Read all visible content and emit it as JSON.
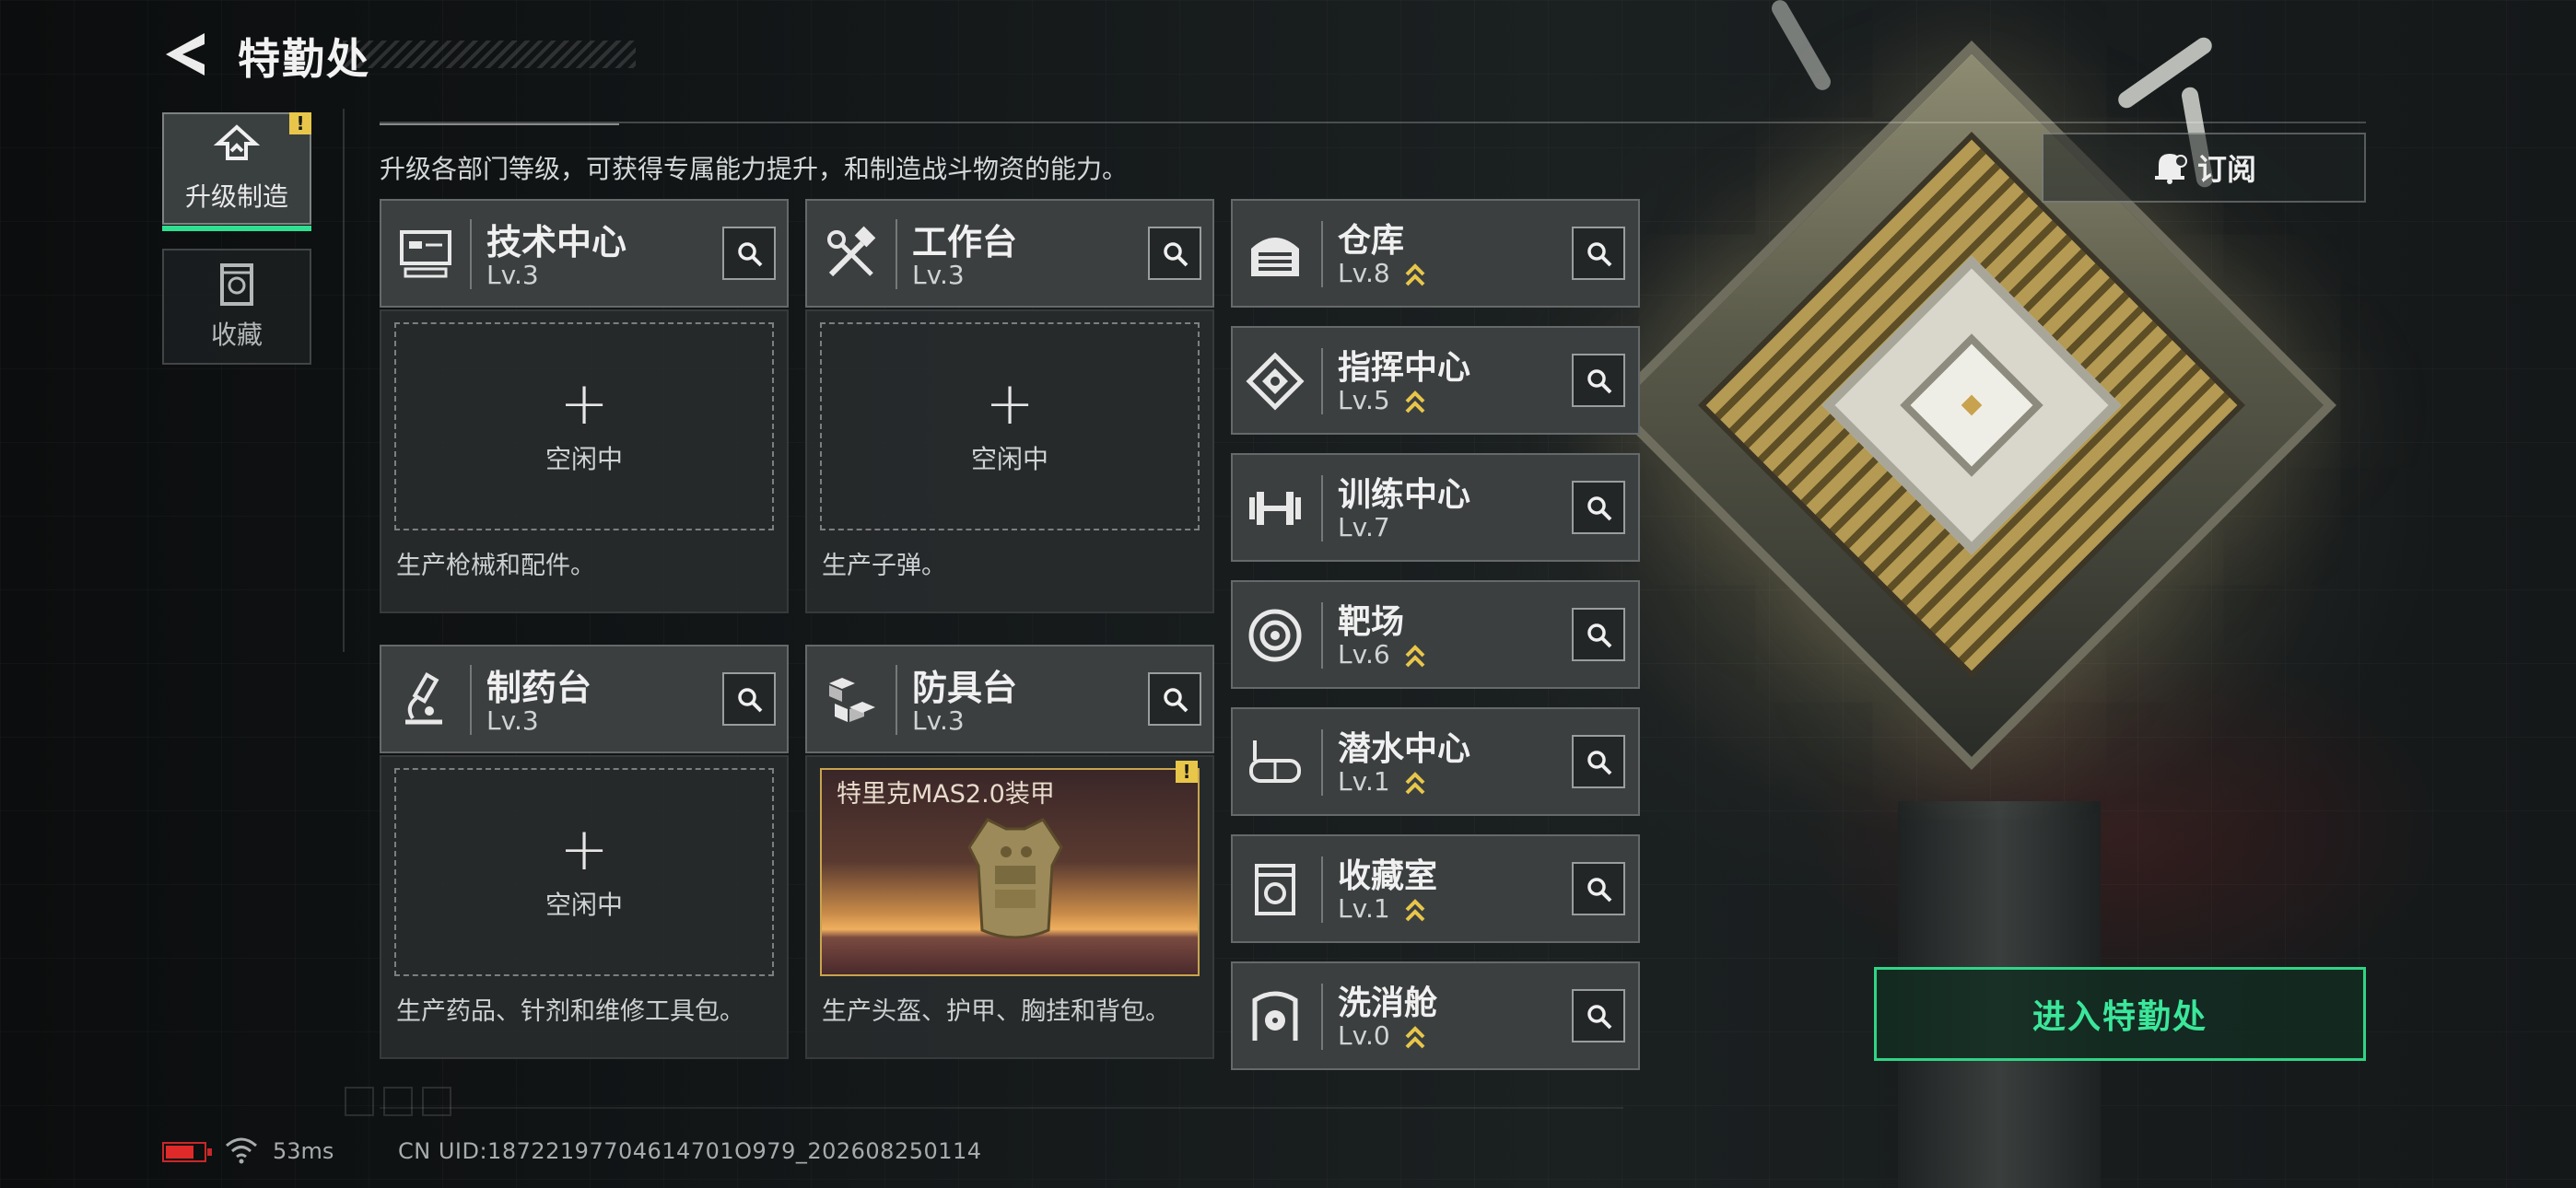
{
  "header": {
    "title": "特勤处",
    "subtitle": "升级各部门等级，可获得专属能力提升，和制造战斗物资的能力。"
  },
  "sidebar": {
    "tabs": [
      {
        "label": "升级制造",
        "icon": "upgrade-icon",
        "active": true,
        "alert": "!"
      },
      {
        "label": "收藏",
        "icon": "collection-icon",
        "active": false
      }
    ]
  },
  "workshops": [
    {
      "name": "技术中心",
      "level": "Lv.3",
      "icon": "computer-icon",
      "status": "空闲中",
      "description": "生产枪械和配件。"
    },
    {
      "name": "工作台",
      "level": "Lv.3",
      "icon": "tools-icon",
      "status": "空闲中",
      "description": "生产子弹。"
    },
    {
      "name": "制药台",
      "level": "Lv.3",
      "icon": "microscope-icon",
      "status": "空闲中",
      "description": "生产药品、针剂和维修工具包。"
    },
    {
      "name": "防具台",
      "level": "Lv.3",
      "icon": "crates-icon",
      "product": "特里克MAS2.0装甲",
      "product_alert": "!",
      "description": "生产头盔、护甲、胸挂和背包。"
    }
  ],
  "plus_symbol": "+",
  "departments": [
    {
      "name": "仓库",
      "level": "Lv.8",
      "icon": "warehouse-icon",
      "upgradeable": true
    },
    {
      "name": "指挥中心",
      "level": "Lv.5",
      "icon": "command-icon",
      "upgradeable": true
    },
    {
      "name": "训练中心",
      "level": "Lv.7",
      "icon": "dumbbell-icon",
      "upgradeable": false
    },
    {
      "name": "靶场",
      "level": "Lv.6",
      "icon": "target-icon",
      "upgradeable": true
    },
    {
      "name": "潜水中心",
      "level": "Lv.1",
      "icon": "diving-mask-icon",
      "upgradeable": true
    },
    {
      "name": "收藏室",
      "level": "Lv.1",
      "icon": "collection-room-icon",
      "upgradeable": true
    },
    {
      "name": "洗消舱",
      "level": "Lv.0",
      "icon": "decontamination-icon",
      "upgradeable": true
    }
  ],
  "actions": {
    "subscribe_label": "订阅",
    "enter_label": "进入特勤处"
  },
  "status_bar": {
    "ping": "53ms",
    "uid": "CN UID:18722197704614701O979_202608250114"
  },
  "colors": {
    "accent_green": "#2fd586",
    "upgrade_gold": "#e8c64a",
    "battery_red": "#e02a2a"
  }
}
